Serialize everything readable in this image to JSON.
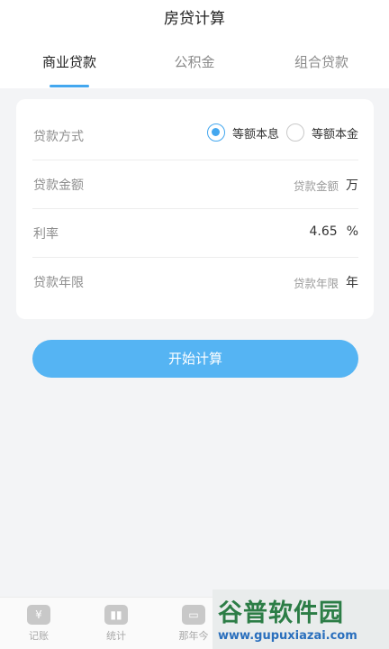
{
  "header": {
    "title": "房贷计算"
  },
  "tabs": [
    {
      "label": "商业贷款",
      "active": true
    },
    {
      "label": "公积金",
      "active": false
    },
    {
      "label": "组合贷款",
      "active": false
    }
  ],
  "form": {
    "repayment": {
      "label": "贷款方式",
      "options": [
        {
          "label": "等额本息",
          "selected": true
        },
        {
          "label": "等额本金",
          "selected": false
        }
      ]
    },
    "amount": {
      "label": "贷款金额",
      "placeholder": "贷款金额",
      "unit": "万"
    },
    "rate": {
      "label": "利率",
      "value": "4.65",
      "unit": "%"
    },
    "term": {
      "label": "贷款年限",
      "placeholder": "贷款年限",
      "unit": "年"
    }
  },
  "calculate_button": "开始计算",
  "bottom_nav": [
    {
      "label": "记账",
      "icon": "yen-icon"
    },
    {
      "label": "统计",
      "icon": "bar-chart-icon"
    },
    {
      "label": "那年今",
      "icon": "calendar-icon"
    }
  ],
  "watermark": {
    "main": "谷普软件园",
    "url": "www.gupuxiazai.com"
  },
  "colors": {
    "accent": "#43a7ef",
    "button": "#55b4f3",
    "background": "#f3f4f6"
  }
}
